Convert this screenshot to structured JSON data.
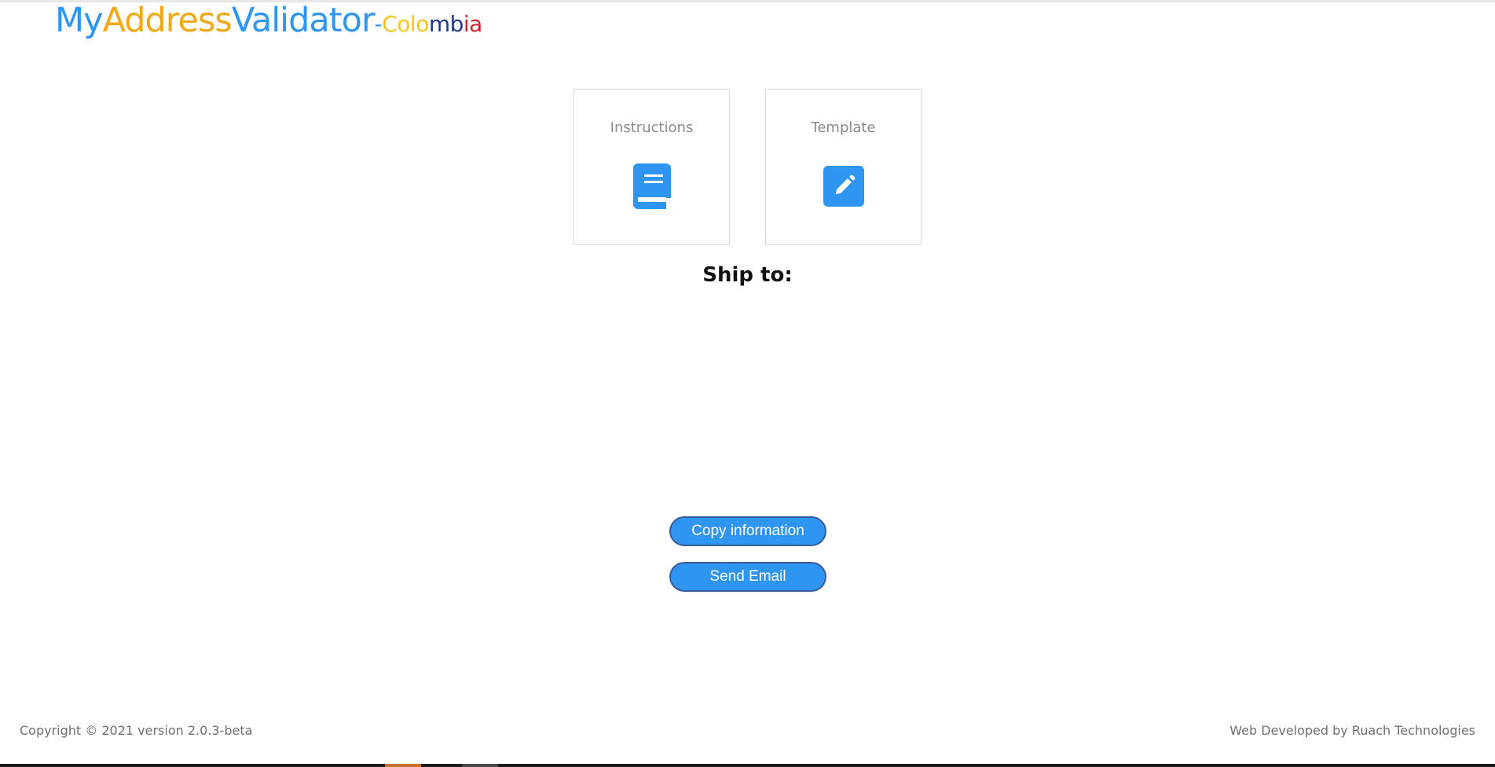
{
  "logo": {
    "my": "My",
    "address": "Address",
    "validator": "Validator",
    "dash": "-",
    "co": "Co",
    "lo": "lo",
    "mb": "mb",
    "ia": "ia"
  },
  "cards": {
    "instructions": {
      "label": "Instructions",
      "icon": "book-icon"
    },
    "template": {
      "label": "Template",
      "icon": "edit-icon"
    }
  },
  "main": {
    "heading": "Ship to:"
  },
  "buttons": {
    "copy": "Copy information",
    "email": "Send Email"
  },
  "footer": {
    "copyright": "Copyright © 2021 version 2.0.3-beta",
    "credit": "Web Developed by Ruach Technologies"
  },
  "colors": {
    "accent": "#2f95f2",
    "orange": "#f2a814",
    "yellow": "#f4c51a",
    "navy": "#1f3a8a",
    "red": "#d1232d"
  }
}
